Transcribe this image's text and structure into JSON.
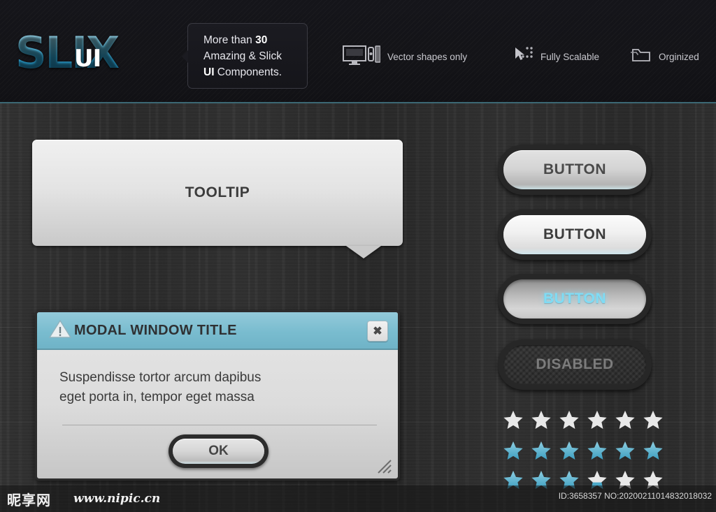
{
  "header": {
    "logo": {
      "text": "SLIX",
      "overlay": "UI"
    },
    "badge": {
      "line1_prefix": "More than ",
      "line1_strong": "30",
      "line2": "Amazing & Slick",
      "line3_strong": "UI",
      "line3_rest": " Components."
    },
    "features": [
      {
        "icon": "devices-icon",
        "label": "Vector shapes only"
      },
      {
        "icon": "cursor-scale-icon",
        "label": "Fully Scalable"
      },
      {
        "icon": "folder-icon",
        "label": "Orginized"
      }
    ]
  },
  "tooltip": {
    "label": "TOOLTIP"
  },
  "modal": {
    "title": "MODAL WINDOW TITLE",
    "warning_icon": "warning-triangle-icon",
    "close_label": "✖",
    "body_lines": [
      "Suspendisse tortor arcum dapibus",
      "eget porta in, tempor eget massa"
    ],
    "ok_label": "OK",
    "resize_icon": "resize-grip-icon"
  },
  "buttons": [
    {
      "label": "BUTTON",
      "state": "normal"
    },
    {
      "label": "BUTTON",
      "state": "hover"
    },
    {
      "label": "BUTTON",
      "state": "active"
    },
    {
      "label": "DISABLED",
      "state": "disabled"
    }
  ],
  "star_rows": [
    {
      "name": "stars-empty-row",
      "fills": [
        0,
        0,
        0,
        0,
        0,
        0
      ]
    },
    {
      "name": "stars-full-row",
      "fills": [
        1,
        1,
        1,
        1,
        1,
        1
      ]
    },
    {
      "name": "stars-partial-row",
      "fills": [
        1,
        1,
        1,
        0.35,
        0,
        0
      ]
    }
  ],
  "colors": {
    "accent_blue": "#7fdcf5",
    "logo_blue": "#2fa6d4",
    "modal_title_bar": "#79bccf",
    "star_blue": "#4aa8c8",
    "star_white": "#e8e8e8",
    "background_dark": "#2e2e2e",
    "header_dark": "#141418"
  },
  "footer": {
    "watermark_logo": "昵享网",
    "watermark_url": "www.nipic.cn",
    "id_text": "ID:3658357 NO:20200211014832018032"
  }
}
